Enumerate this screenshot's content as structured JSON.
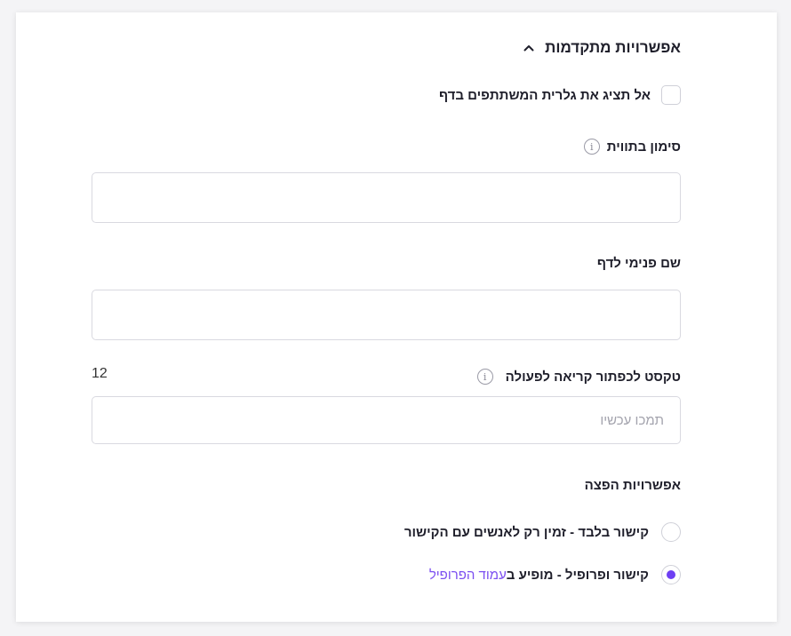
{
  "section": {
    "title": "אפשרויות מתקדמות",
    "expanded": true
  },
  "hide_gallery": {
    "label": "אל תציג את גלרית המשתתפים בדף",
    "checked": false
  },
  "label_field": {
    "label": "סימון בתווית",
    "value": "",
    "info_icon": "info-icon"
  },
  "internal_name_field": {
    "label": "שם פנימי לדף",
    "value": ""
  },
  "cta_field": {
    "label": "טקסט לכפתור קריאה לפעולה",
    "placeholder": "תמכו עכשיו",
    "counter": "12",
    "info_icon": "info-icon"
  },
  "distribution": {
    "title": "אפשרויות הפצה",
    "options": [
      {
        "label": "קישור בלבד - זמין רק לאנשים עם הקישור",
        "selected": false
      },
      {
        "label_prefix": "קישור ופרופיל - מופיע ב",
        "link_text": "עמוד הפרופיל",
        "selected": true
      }
    ]
  },
  "colors": {
    "accent": "#6e3ff3",
    "link": "#7b4ef0",
    "border": "#d9d9e0"
  }
}
